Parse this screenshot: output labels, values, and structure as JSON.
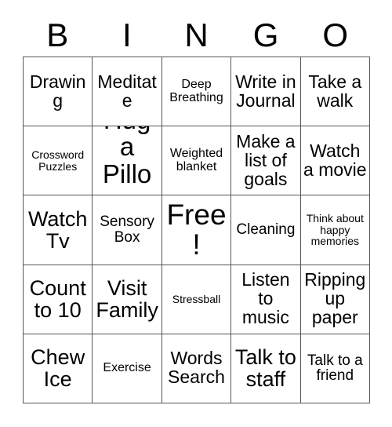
{
  "card": {
    "title_letters": [
      "B",
      "I",
      "N",
      "G",
      "O"
    ],
    "grid_size": 5,
    "colors": {
      "text": "#000000",
      "border": "#555555",
      "background": "#ffffff"
    },
    "rows": [
      [
        {
          "text": "Drawing",
          "size": "fs-l",
          "free": false
        },
        {
          "text": "Meditate",
          "size": "fs-l",
          "free": false
        },
        {
          "text": "Deep Breathing",
          "size": "fs-s",
          "free": false
        },
        {
          "text": "Write in Journal",
          "size": "fs-l",
          "free": false
        },
        {
          "text": "Take a walk",
          "size": "fs-l",
          "free": false
        }
      ],
      [
        {
          "text": "Crossword Puzzles",
          "size": "fs-xs",
          "free": false
        },
        {
          "text": "Hug a Pillow",
          "size": "fs-xxl",
          "free": false
        },
        {
          "text": "Weighted blanket",
          "size": "fs-s",
          "free": false
        },
        {
          "text": "Make a list of goals",
          "size": "fs-l",
          "free": false
        },
        {
          "text": "Watch a movie",
          "size": "fs-l",
          "free": false
        }
      ],
      [
        {
          "text": "Watch Tv",
          "size": "fs-xl",
          "free": false
        },
        {
          "text": "Sensory Box",
          "size": "fs-m",
          "free": false
        },
        {
          "text": "Free!",
          "size": "fs-free",
          "free": true
        },
        {
          "text": "Cleaning",
          "size": "fs-m",
          "free": false
        },
        {
          "text": "Think about happy memories",
          "size": "fs-xs",
          "free": false
        }
      ],
      [
        {
          "text": "Count to 10",
          "size": "fs-xl",
          "free": false
        },
        {
          "text": "Visit Family",
          "size": "fs-xl",
          "free": false
        },
        {
          "text": "Stressball",
          "size": "fs-xs",
          "free": false
        },
        {
          "text": "Listen to music",
          "size": "fs-l",
          "free": false
        },
        {
          "text": "Ripping up paper",
          "size": "fs-l",
          "free": false
        }
      ],
      [
        {
          "text": "Chew Ice",
          "size": "fs-xl",
          "free": false
        },
        {
          "text": "Exercise",
          "size": "fs-s",
          "free": false
        },
        {
          "text": "Words Search",
          "size": "fs-l",
          "free": false
        },
        {
          "text": "Talk to staff",
          "size": "fs-xl",
          "free": false
        },
        {
          "text": "Talk to a friend",
          "size": "fs-m",
          "free": false
        }
      ]
    ]
  }
}
